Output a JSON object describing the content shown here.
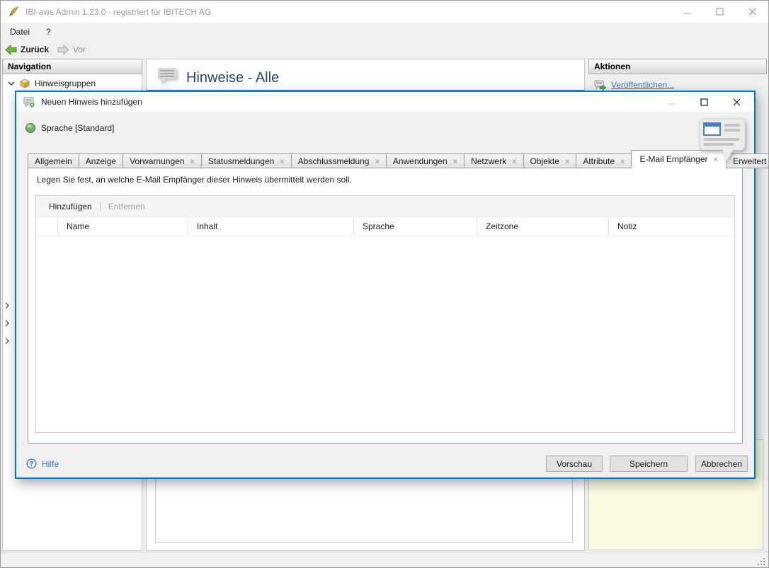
{
  "window": {
    "title": "IBI-aws Admin 1.23.0 - registriert für IBITECH AG"
  },
  "menubar": {
    "items": [
      "Datei",
      "?"
    ]
  },
  "toolbar": {
    "back_label": "Zurück",
    "forward_label": "Vor"
  },
  "navigation": {
    "header": "Navigation",
    "root_item": "Hinweisgruppen"
  },
  "main": {
    "title": "Hinweise - Alle"
  },
  "actions": {
    "header": "Aktionen",
    "publish_label": "Veröffentlichen..."
  },
  "dialog": {
    "title": "Neuen Hinweis hinzufügen",
    "language_label": "Sprache [Standard]",
    "tabs": [
      {
        "label": "Allgemein",
        "closable": false,
        "active": false
      },
      {
        "label": "Anzeige",
        "closable": false,
        "active": false
      },
      {
        "label": "Vorwarnungen",
        "closable": true,
        "active": false
      },
      {
        "label": "Statusmeldungen",
        "closable": true,
        "active": false
      },
      {
        "label": "Abschlussmeldung",
        "closable": true,
        "active": false
      },
      {
        "label": "Anwendungen",
        "closable": true,
        "active": false
      },
      {
        "label": "Netzwerk",
        "closable": true,
        "active": false
      },
      {
        "label": "Objekte",
        "closable": true,
        "active": false
      },
      {
        "label": "Attribute",
        "closable": true,
        "active": false
      },
      {
        "label": "E-Mail Empfänger",
        "closable": true,
        "active": true
      },
      {
        "label": "Erweitert",
        "closable": false,
        "active": false
      }
    ],
    "description": "Legen Sie fest, an welche E-Mail Empfänger dieser Hinweis übermittelt werden soll.",
    "table": {
      "toolbar": {
        "add_label": "Hinzufügen",
        "remove_label": "Entfernen"
      },
      "columns": [
        "Name",
        "Inhalt",
        "Sprache",
        "Zeitzone",
        "Notiz"
      ],
      "rows": []
    },
    "footer": {
      "help_label": "Hilfe",
      "preview_label": "Vorschau",
      "save_label": "Speichern",
      "cancel_label": "Abbrechen"
    }
  },
  "colors": {
    "dialog_accent_border": "#0078d7",
    "link_blue": "#3879ab",
    "header_underline_blue": "#3d9bd7",
    "note_panel_yellow": "#fafae1",
    "back_arrow_green": "#76b13f"
  }
}
